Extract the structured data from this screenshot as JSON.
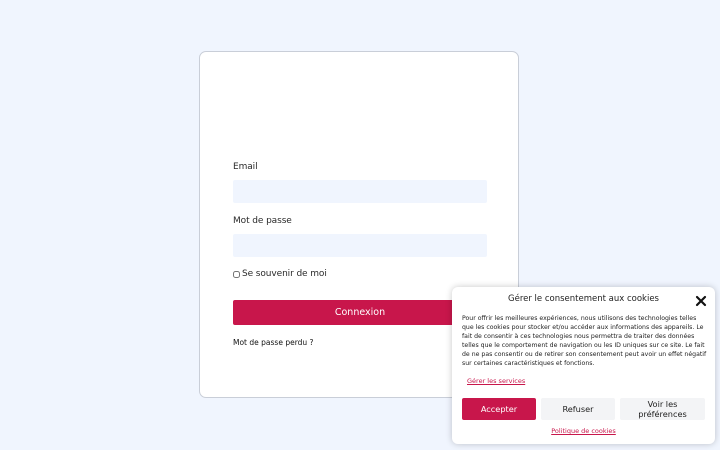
{
  "login": {
    "email_label": "Email",
    "email_value": "",
    "password_label": "Mot de passe",
    "password_value": "",
    "remember_label": "Se souvenir de moi",
    "remember_checked": false,
    "submit_label": "Connexion",
    "lost_password_label": "Mot de passe perdu ?"
  },
  "cookie": {
    "title": "Gérer le consentement aux cookies",
    "text": "Pour offrir les meilleures expériences, nous utilisons des technologies telles que les cookies pour stocker et/ou accéder aux informations des appareils. Le fait de consentir à ces technologies nous permettra de traiter des données telles que le comportement de navigation ou les ID uniques sur ce site. Le fait de ne pas consentir ou de retirer son consentement peut avoir un effet négatif sur certaines caractéristiques et fonctions.",
    "manage_services_label": "Gérer les services",
    "accept_label": "Accepter",
    "refuse_label": "Refuser",
    "preferences_label": "Voir les préférences",
    "policy_label": "Politique de cookies",
    "close_icon": "close-icon"
  },
  "colors": {
    "accent": "#c8164b",
    "page_background": "#f0f5fe",
    "input_background": "#f0f5fe"
  }
}
